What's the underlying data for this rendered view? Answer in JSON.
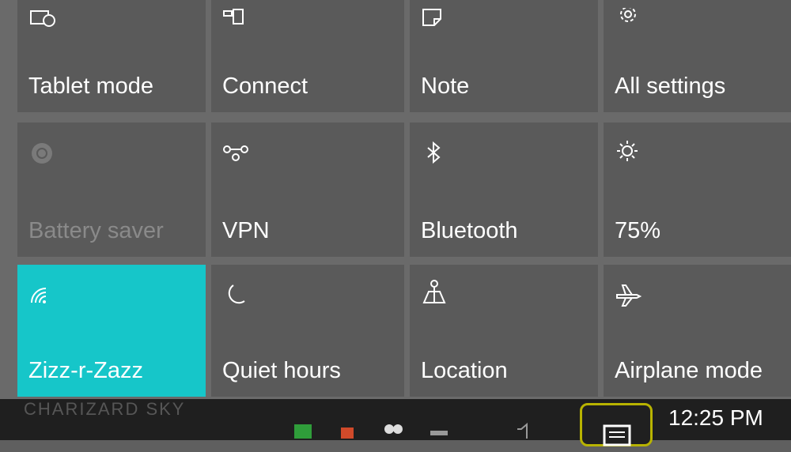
{
  "tiles": [
    {
      "label": "Tablet mode",
      "icon": "tablet-mode-icon"
    },
    {
      "label": "Connect",
      "icon": "connect-icon"
    },
    {
      "label": "Note",
      "icon": "note-icon"
    },
    {
      "label": "All settings",
      "icon": "gear-icon"
    },
    {
      "label": "Battery saver",
      "icon": "battery-saver-icon"
    },
    {
      "label": "VPN",
      "icon": "vpn-icon"
    },
    {
      "label": "Bluetooth",
      "icon": "bluetooth-icon"
    },
    {
      "label": "75%",
      "icon": "brightness-icon"
    },
    {
      "label": "Zizz-r-Zazz",
      "icon": "wifi-icon"
    },
    {
      "label": "Quiet hours",
      "icon": "moon-icon"
    },
    {
      "label": "Location",
      "icon": "location-icon"
    },
    {
      "label": "Airplane mode",
      "icon": "airplane-icon"
    }
  ],
  "taskbar": {
    "ghost_text": "CHARIZARD SKY",
    "clock": "12:25 PM"
  },
  "colors": {
    "tile": "#5a5a5a",
    "active_tile": "#16c6c9",
    "ac_highlight": "#b8b300"
  }
}
